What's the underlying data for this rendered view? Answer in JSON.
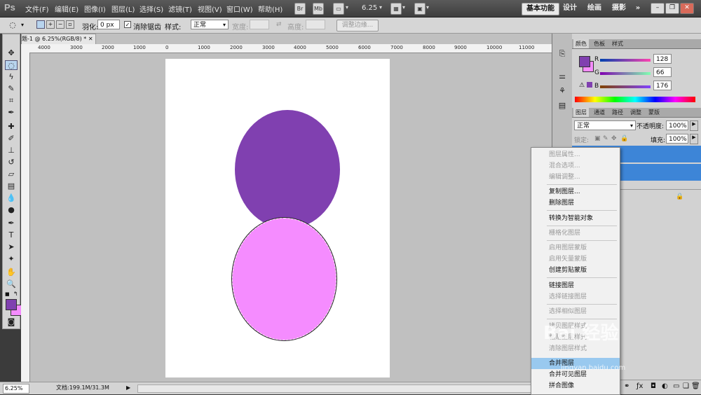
{
  "app": {
    "logo": "Ps"
  },
  "menus": [
    "文件(F)",
    "编辑(E)",
    "图像(I)",
    "图层(L)",
    "选择(S)",
    "滤镜(T)",
    "视图(V)",
    "窗口(W)",
    "帮助(H)"
  ],
  "menubar_icons": {
    "br": "Br",
    "mb": "Mb",
    "zoom": "6.25"
  },
  "workspaces": [
    "基本功能",
    "设计",
    "绘画",
    "摄影",
    "»"
  ],
  "options": {
    "feather_label": "羽化:",
    "feather_value": "0 px",
    "antialias_label": "消除锯齿",
    "style_label": "样式:",
    "style_value": "正常",
    "width_label": "宽度:",
    "height_label": "高度:",
    "refine_edge": "调整边缘..."
  },
  "document": {
    "tab_title": "题-1 @ 6.25%(RGB/8) *",
    "ruler_labels": [
      "4000",
      "3000",
      "2000",
      "1000",
      "0",
      "1000",
      "2000",
      "3000",
      "4000",
      "5000",
      "6000",
      "7000",
      "8000",
      "9000",
      "10000",
      "11000"
    ],
    "colors": {
      "circle_top": "#8040B0",
      "circle_bottom": "#F58CFF",
      "canvas": "#FFFFFF"
    }
  },
  "status": {
    "zoom": "6.25%",
    "doc_info": "文档:199.1M/31.3M"
  },
  "color_panel": {
    "tabs": [
      "颜色",
      "色板",
      "样式"
    ],
    "r_label": "R",
    "g_label": "G",
    "b_label": "B",
    "r": "128",
    "g": "66",
    "b": "176",
    "foreground": "#8040B0",
    "background": "#F58CFF"
  },
  "layers_panel": {
    "tabs": [
      "图层",
      "通道",
      "路径",
      "调整",
      "蒙版"
    ],
    "blend_mode": "正常",
    "opacity_label": "不透明度:",
    "opacity_value": "100%",
    "lock_label": "锁定:",
    "fill_label": "填充:",
    "fill_value": "100%"
  },
  "context_menu": {
    "items": [
      {
        "label": "图层属性...",
        "enabled": false
      },
      {
        "label": "混合选项...",
        "enabled": false
      },
      {
        "label": "编辑调整...",
        "enabled": false
      },
      {
        "label": "复制图层...",
        "enabled": true
      },
      {
        "label": "删除图层",
        "enabled": true
      },
      {
        "label": "转换为智能对象",
        "enabled": true
      },
      {
        "label": "栅格化图层",
        "enabled": false
      },
      {
        "label": "启用图层蒙版",
        "enabled": false
      },
      {
        "label": "启用矢量蒙版",
        "enabled": false
      },
      {
        "label": "创建剪贴蒙版",
        "enabled": true
      },
      {
        "label": "链接图层",
        "enabled": true
      },
      {
        "label": "选择链接图层",
        "enabled": false
      },
      {
        "label": "选择相似图层",
        "enabled": false
      },
      {
        "label": "拷贝图层样式",
        "enabled": false
      },
      {
        "label": "粘贴图层样式",
        "enabled": false
      },
      {
        "label": "清除图层样式",
        "enabled": false
      },
      {
        "label": "合并图层",
        "enabled": true,
        "highlighted": true
      },
      {
        "label": "合并可见图层",
        "enabled": true
      },
      {
        "label": "拼合图像",
        "enabled": true
      }
    ]
  },
  "watermark": {
    "text": "Bai 经验",
    "sub": "jingyan.baidu.com"
  }
}
